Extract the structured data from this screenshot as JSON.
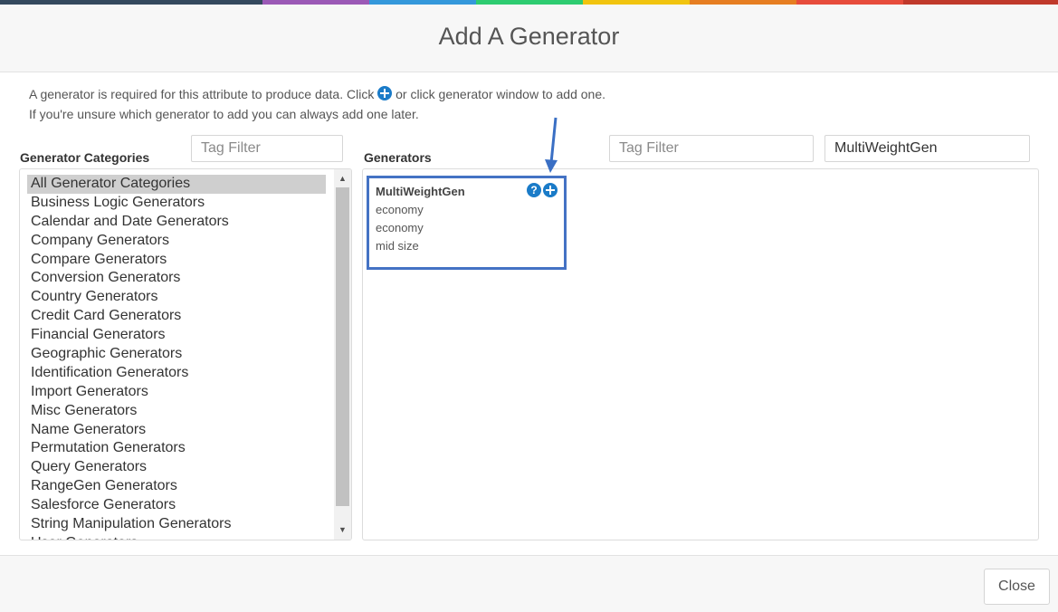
{
  "top_strip_colors": [
    "#34495e",
    "#9b59b6",
    "#3498db",
    "#2ecc71",
    "#f1c40f",
    "#e67e22",
    "#e74c3c",
    "#c0392b"
  ],
  "header": {
    "title": "Add A Generator"
  },
  "intro": {
    "line1_before": "A generator is required for this attribute to produce data. Click ",
    "line1_after": " or click generator window to add one.",
    "line2": "If you're unsure which generator to add you can always add one later."
  },
  "categories_panel": {
    "title": "Generator Categories",
    "tag_filter_placeholder": "Tag Filter",
    "items": [
      "All Generator Categories",
      "Business Logic Generators",
      "Calendar and Date Generators",
      "Company Generators",
      "Compare Generators",
      "Conversion Generators",
      "Country Generators",
      "Credit Card Generators",
      "Financial Generators",
      "Geographic Generators",
      "Identification Generators",
      "Import Generators",
      "Misc Generators",
      "Name Generators",
      "Permutation Generators",
      "Query Generators",
      "RangeGen Generators",
      "Salesforce Generators",
      "String Manipulation Generators",
      "User Generators"
    ],
    "selected_index": 0
  },
  "generators_panel": {
    "title": "Generators",
    "tag_filter_placeholder": "Tag Filter",
    "search_value": "MultiWeightGen",
    "cards": [
      {
        "name": "MultiWeightGen",
        "samples": [
          "economy",
          "economy",
          "mid size"
        ]
      }
    ]
  },
  "icons": {
    "help": "question-circle-icon",
    "add": "plus-circle-icon",
    "annotation": "arrow-down-icon"
  },
  "colors": {
    "accent": "#1a7bc8",
    "highlight_border": "#4472c4",
    "selected_row": "#cfcfcf"
  },
  "footer": {
    "close_label": "Close"
  }
}
